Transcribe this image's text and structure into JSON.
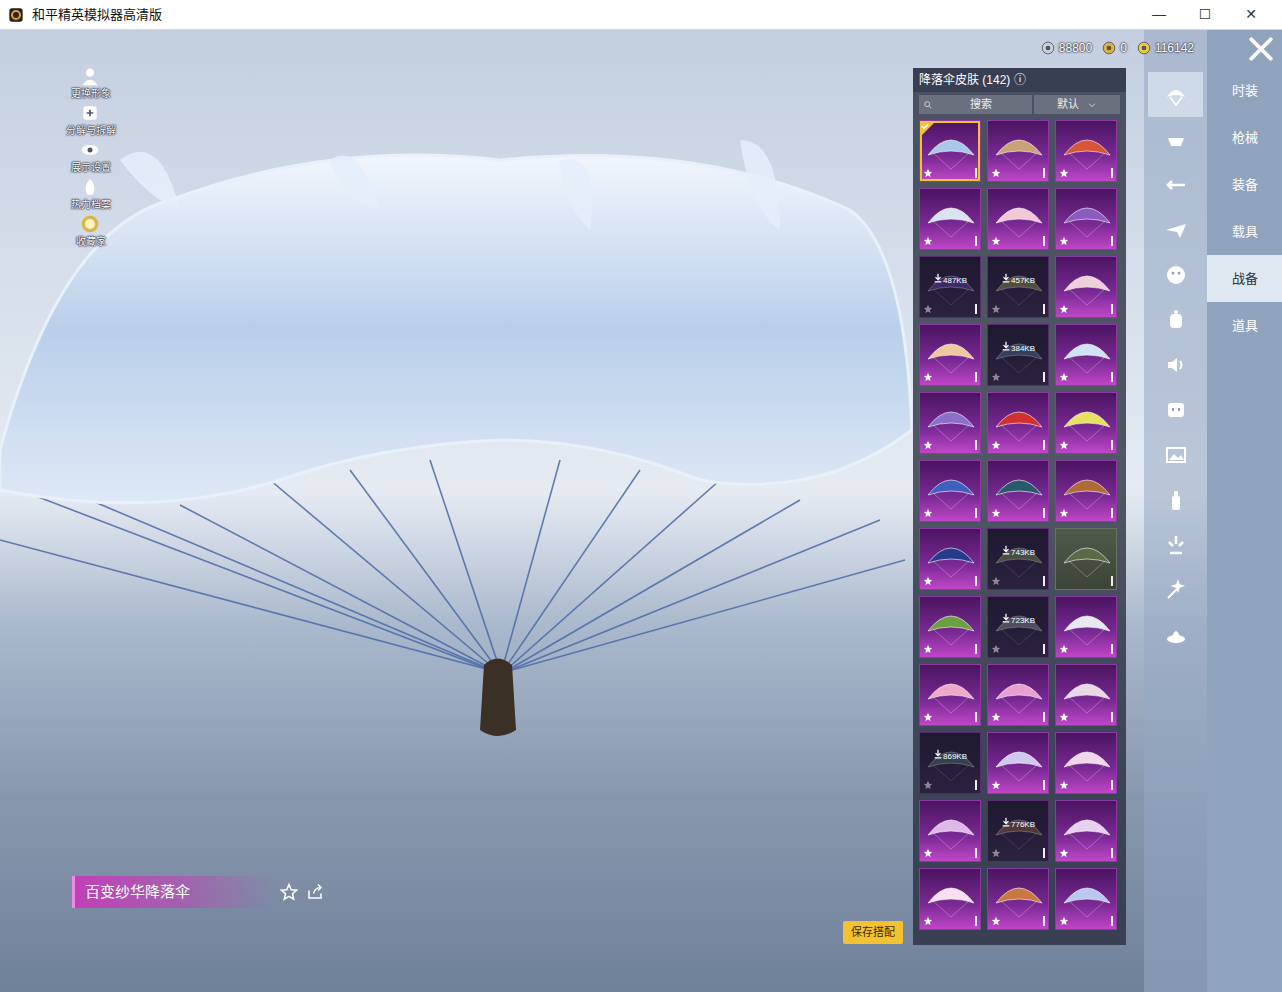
{
  "window": {
    "title": "和平精英模拟器高清版",
    "controls": [
      "—",
      "☐",
      "✕"
    ]
  },
  "scene_tools": [
    {
      "label": "更换形象"
    },
    {
      "label": "分解与拆解"
    },
    {
      "label": "展示设置"
    },
    {
      "label": "热力档案"
    },
    {
      "label": "收藏家"
    }
  ],
  "currencies": [
    {
      "amount": "88800"
    },
    {
      "amount": "0"
    },
    {
      "amount": "116142"
    }
  ],
  "panel": {
    "title": "降落伞皮肤 (142)",
    "info": "ⓘ",
    "search": "搜索",
    "sort": "默认",
    "skins": [
      {
        "kind": "owned",
        "color": "#a9c8e8",
        "selected": true
      },
      {
        "kind": "owned",
        "color": "#c9a27a",
        "selected": false
      },
      {
        "kind": "owned",
        "color": "#d9553a",
        "selected": false
      },
      {
        "kind": "owned",
        "color": "#d9e4f0",
        "selected": false
      },
      {
        "kind": "owned",
        "color": "#f3c8d8",
        "selected": false
      },
      {
        "kind": "owned",
        "color": "#8a5cc0",
        "selected": false
      },
      {
        "kind": "download",
        "color": "#5a3aa0",
        "size": "487KB",
        "selected": false
      },
      {
        "kind": "download",
        "color": "#8a8a4a",
        "size": "457KB",
        "selected": false
      },
      {
        "kind": "owned",
        "color": "#f0d0d8",
        "selected": false
      },
      {
        "kind": "owned",
        "color": "#f0c8a0",
        "selected": false
      },
      {
        "kind": "download",
        "color": "#4a6a88",
        "size": "384KB",
        "selected": false
      },
      {
        "kind": "owned",
        "color": "#cfe2f6",
        "selected": false
      },
      {
        "kind": "owned",
        "color": "#8a70c8",
        "selected": false
      },
      {
        "kind": "owned",
        "color": "#d23030",
        "selected": false
      },
      {
        "kind": "owned",
        "color": "#e8e060",
        "selected": false
      },
      {
        "kind": "owned",
        "color": "#4060c0",
        "selected": false
      },
      {
        "kind": "owned",
        "color": "#2a5a6a",
        "selected": false
      },
      {
        "kind": "owned",
        "color": "#b06a3a",
        "selected": false
      },
      {
        "kind": "owned",
        "color": "#283a8a",
        "selected": false
      },
      {
        "kind": "download",
        "color": "#7a8a4a",
        "size": "743KB",
        "selected": false
      },
      {
        "kind": "plain",
        "color": "#5c6a48",
        "selected": false
      },
      {
        "kind": "owned",
        "color": "#6aa040",
        "selected": false
      },
      {
        "kind": "download",
        "color": "#888888",
        "size": "723KB",
        "selected": false
      },
      {
        "kind": "owned",
        "color": "#e8e8f0",
        "selected": false
      },
      {
        "kind": "owned",
        "color": "#f0a8c8",
        "selected": false
      },
      {
        "kind": "owned",
        "color": "#e8a0d0",
        "selected": false
      },
      {
        "kind": "owned",
        "color": "#e8d8e8",
        "selected": false
      },
      {
        "kind": "download",
        "color": "#4a6a6a",
        "size": "869KB",
        "selected": false
      },
      {
        "kind": "owned",
        "color": "#d0c8f0",
        "selected": false
      },
      {
        "kind": "owned",
        "color": "#f0d8e8",
        "selected": false
      },
      {
        "kind": "owned",
        "color": "#e0b8e8",
        "selected": false
      },
      {
        "kind": "download",
        "color": "#8a5a3a",
        "size": "776KB",
        "selected": false
      },
      {
        "kind": "owned",
        "color": "#e8d0f0",
        "selected": false
      },
      {
        "kind": "owned",
        "color": "#f8e0f0",
        "selected": false
      },
      {
        "kind": "owned",
        "color": "#c87840",
        "selected": false
      },
      {
        "kind": "owned",
        "color": "#b8c8f0",
        "selected": false
      }
    ]
  },
  "item_name": "百变纱华降落伞",
  "save_button": "保存搭配",
  "icon_tabs": [
    {
      "selected": true
    },
    {
      "selected": false
    },
    {
      "selected": false
    },
    {
      "selected": false
    },
    {
      "selected": false
    },
    {
      "selected": false
    },
    {
      "selected": false
    },
    {
      "selected": false
    },
    {
      "selected": false
    },
    {
      "selected": false
    },
    {
      "selected": false
    },
    {
      "selected": false
    },
    {
      "selected": false
    }
  ],
  "categories": [
    {
      "label": "时装",
      "selected": false
    },
    {
      "label": "枪械",
      "selected": false
    },
    {
      "label": "装备",
      "selected": false
    },
    {
      "label": "载具",
      "selected": false
    },
    {
      "label": "战备",
      "selected": true
    },
    {
      "label": "道具",
      "selected": false
    }
  ]
}
